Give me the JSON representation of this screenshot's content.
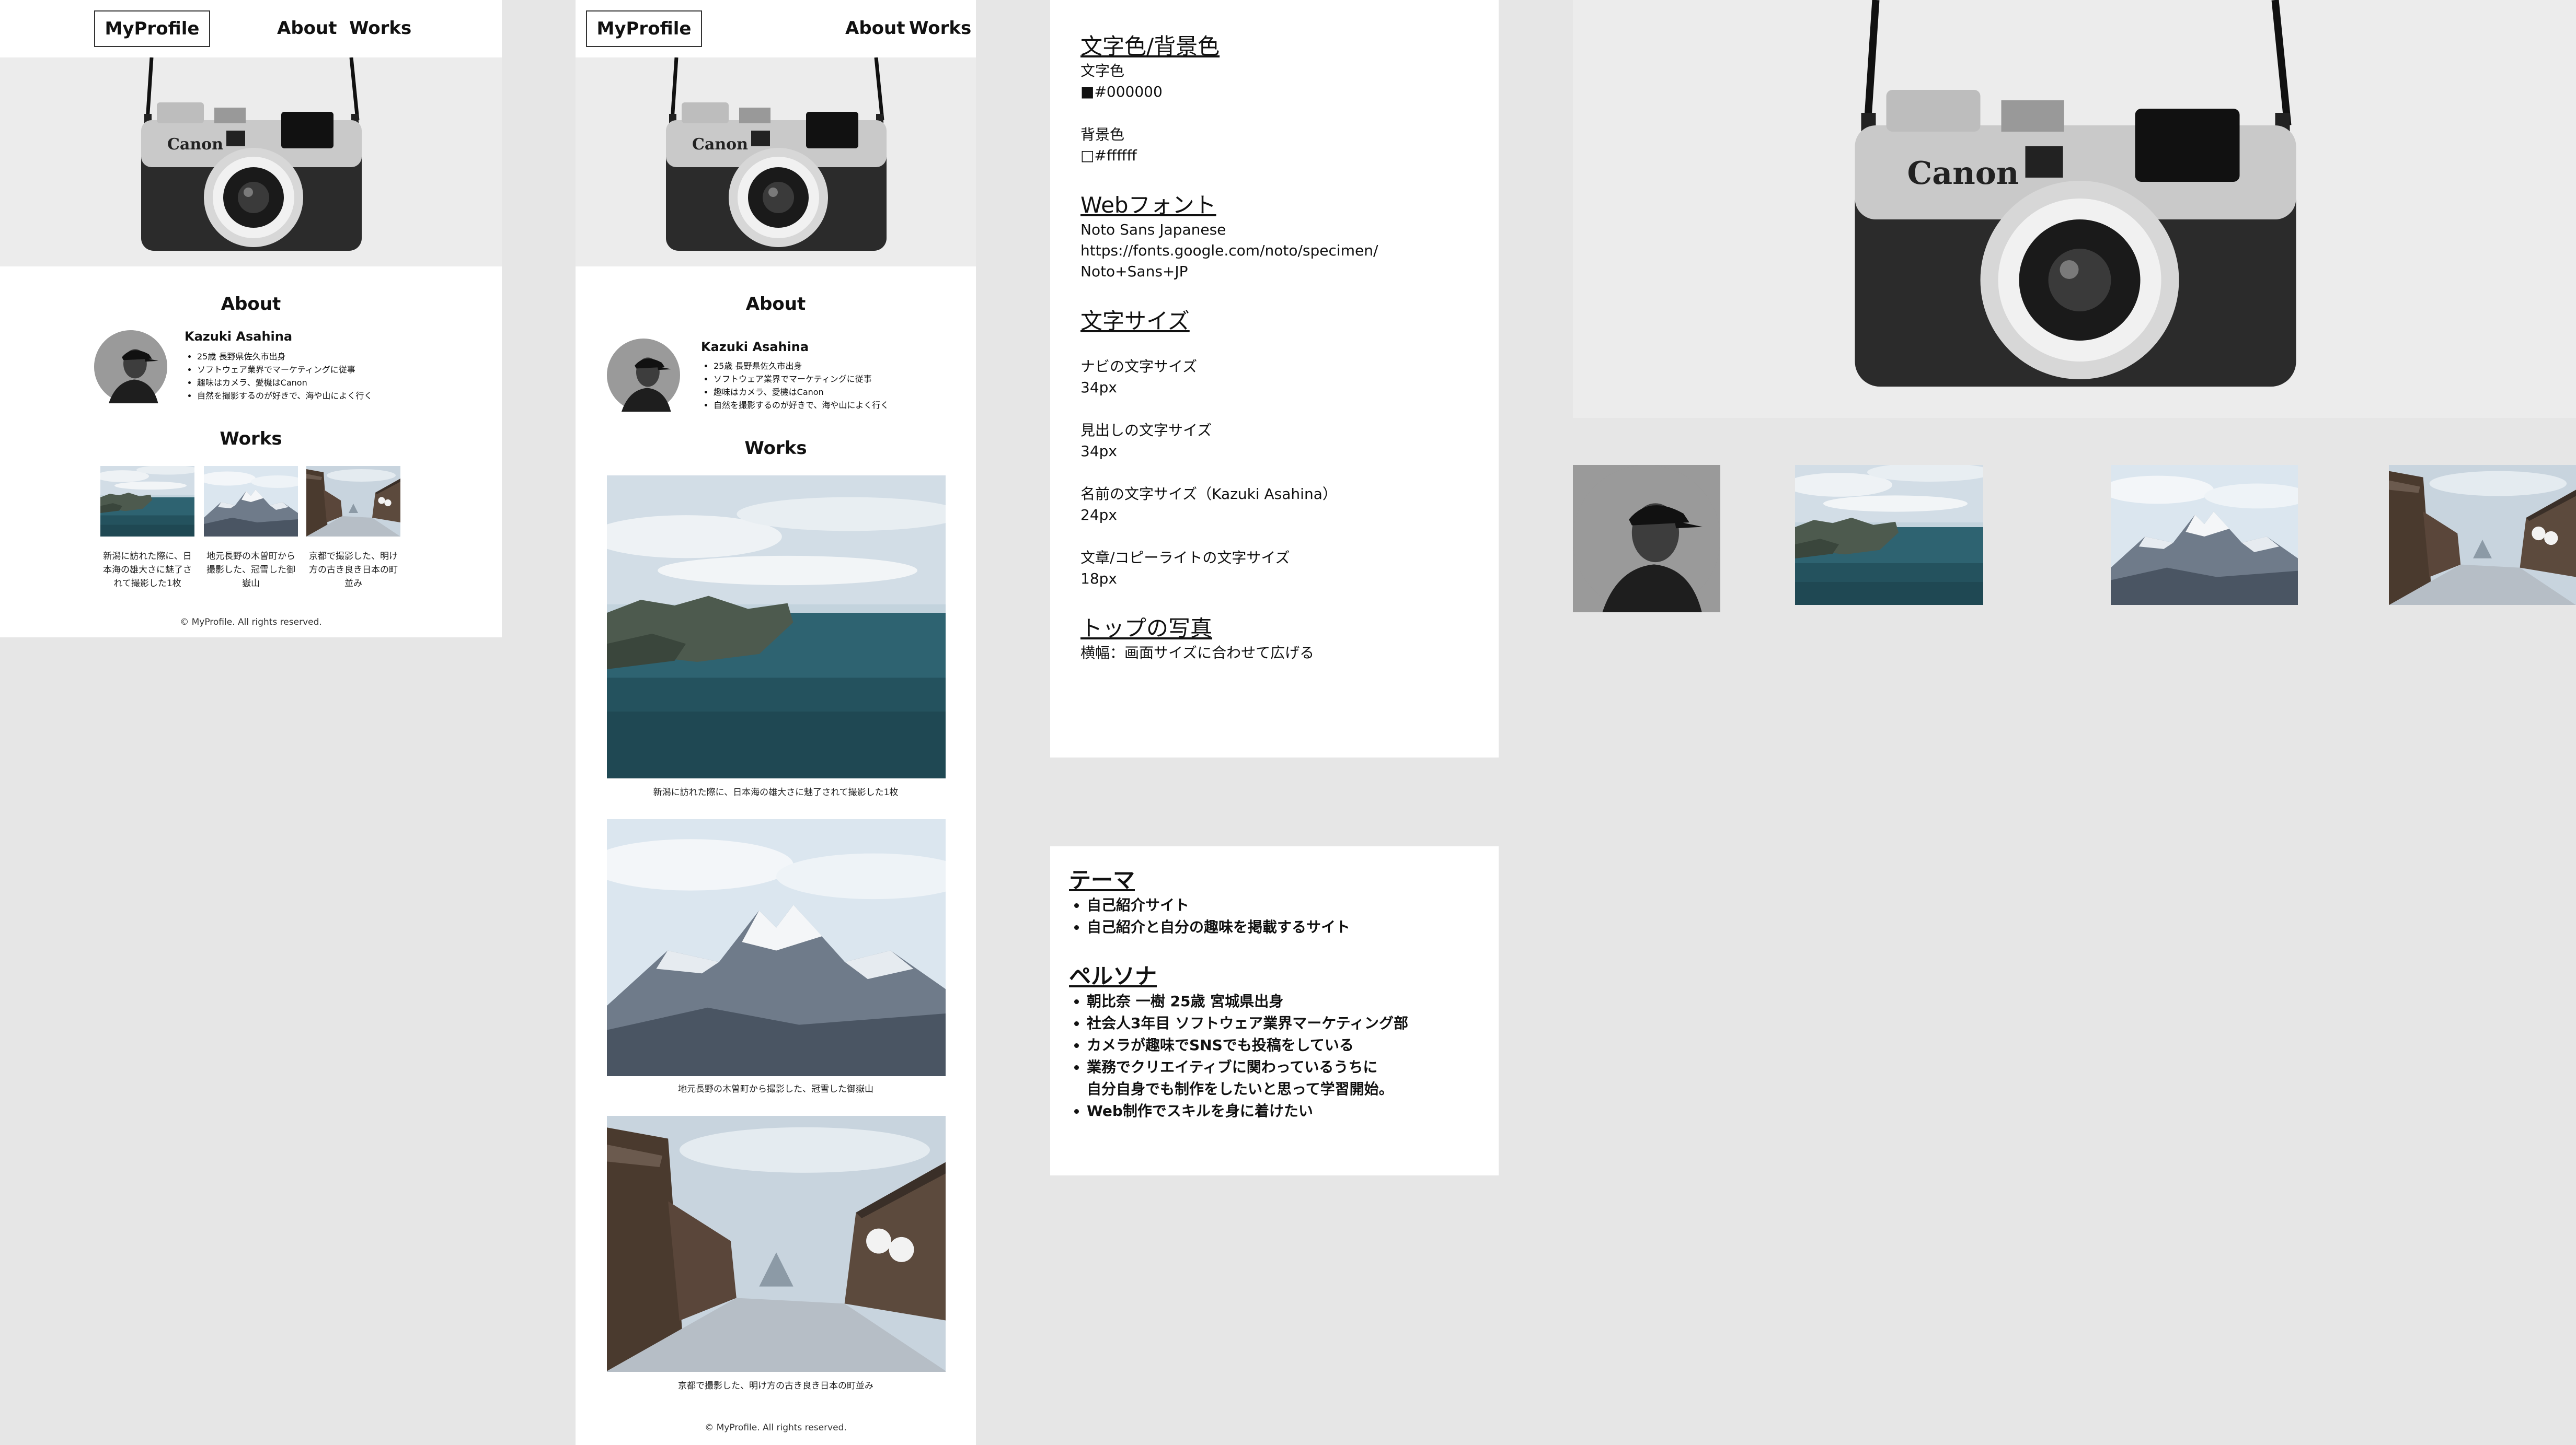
{
  "site": {
    "logo": "MyProfile",
    "nav": [
      "About",
      "Works"
    ],
    "about_heading": "About",
    "name": "Kazuki Asahina",
    "bio": [
      "25歳 長野県佐久市出身",
      "ソフトウェア業界でマーケティングに従事",
      "趣味はカメラ、愛機はCanon",
      "自然を撮影するのが好きで、海や山によく行く"
    ],
    "works_heading": "Works",
    "works_desktop": [
      "新潟に訪れた際に、日本海の雄大さに魅了されて撮影した1枚",
      "地元長野の木曽町から撮影した、冠雪した御嶽山",
      "京都で撮影した、明け方の古き良き日本の町並み"
    ],
    "works_mobile": [
      "新潟に訪れた際に、日本海の雄大さに魅了されて撮影した1枚",
      "地元長野の木曽町から撮影した、冠雪した御嶽山",
      "京都で撮影した、明け方の古き良き日本の町並み"
    ],
    "copyright": "© MyProfile. All rights reserved."
  },
  "spec": {
    "color_heading": "文字色/背景色",
    "text_color_label": "文字色",
    "text_color_value": "■#000000",
    "bg_color_label": "背景色",
    "bg_color_value": "□#ffffff",
    "font_heading": "Webフォント",
    "font_name": "Noto Sans Japanese",
    "font_url_1": "https://fonts.google.com/noto/specimen/",
    "font_url_2": "Noto+Sans+JP",
    "size_heading": "文字サイズ",
    "nav_size_label": "ナビの文字サイズ",
    "nav_size_value": "34px",
    "heading_size_label": "見出しの文字サイズ",
    "heading_size_value": "34px",
    "name_size_label": "名前の文字サイズ（Kazuki Asahina）",
    "name_size_value": "24px",
    "body_size_label": "文章/コピーライトの文字サイズ",
    "body_size_value": "18px",
    "top_photo_heading": "トップの写真",
    "top_photo_text": "横幅：画面サイズに合わせて広げる"
  },
  "theme": {
    "theme_heading": "テーマ",
    "theme_items": [
      "自己紹介サイト",
      "自己紹介と自分の趣味を掲載するサイト"
    ],
    "persona_heading": "ペルソナ",
    "persona_items": [
      "朝比奈 一樹 25歳 宮城県出身",
      "社会人3年目 ソフトウェア業界マーケティング部",
      "カメラが趣味でSNSでも投稿をしている",
      "業務でクリエイティブに関わっているうちに",
      "自分自身でも制作をしたいと思って学習開始。",
      "Web制作でスキルを身に着けたい"
    ]
  },
  "colors": {
    "page_bg": "#e6e6e6",
    "card_bg": "#ffffff",
    "text": "#000000",
    "sea": "#2f6673",
    "sky": "#b9cddb"
  }
}
